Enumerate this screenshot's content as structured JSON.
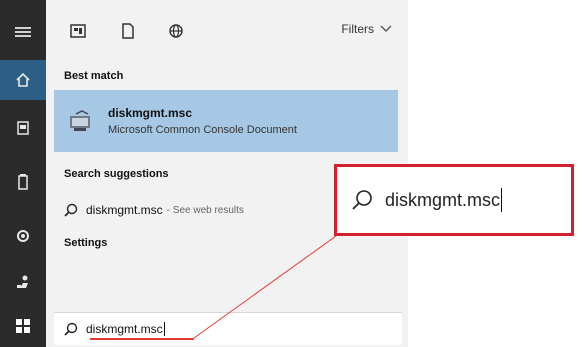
{
  "rail": {
    "items": [
      {
        "name": "menu-icon"
      },
      {
        "name": "home-icon",
        "active": true
      },
      {
        "name": "documents-icon"
      },
      {
        "name": "battery-icon"
      },
      {
        "name": "settings-gear-icon"
      },
      {
        "name": "people-icon"
      },
      {
        "name": "windows-start-icon"
      }
    ]
  },
  "topbar": {
    "filters_label": "Filters"
  },
  "sections": {
    "best_match": "Best match",
    "search_suggestions": "Search suggestions",
    "settings": "Settings"
  },
  "best_match": {
    "title": "diskmgmt.msc",
    "subtitle": "Microsoft Common Console Document"
  },
  "suggestion": {
    "query": "diskmgmt.msc",
    "hint": "- See web results"
  },
  "search": {
    "value": "diskmgmt.msc"
  },
  "zoom": {
    "value": "diskmgmt.msc"
  },
  "colors": {
    "accent_red": "#d3202c",
    "selection_blue": "#a6c8e5",
    "rail_dark": "#2b2b2b"
  }
}
